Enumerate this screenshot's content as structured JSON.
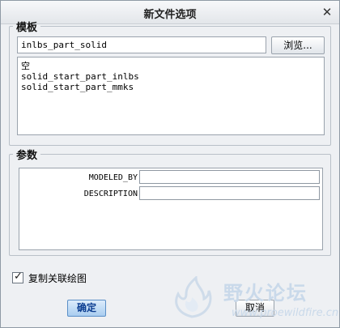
{
  "dialog": {
    "title": "新文件选项",
    "close_icon": "close-icon"
  },
  "template": {
    "legend": "模板",
    "input_value": "inlbs_part_solid",
    "browse_label": "浏览...",
    "items": [
      "空",
      "solid_start_part_inlbs",
      "solid_start_part_mmks"
    ]
  },
  "params": {
    "legend": "参数",
    "rows": [
      {
        "label": "MODELED_BY",
        "value": ""
      },
      {
        "label": "DESCRIPTION",
        "value": ""
      }
    ]
  },
  "copy_assoc": {
    "label": "复制关联绘图",
    "checked": true
  },
  "buttons": {
    "ok_label": "确定",
    "cancel_label": "取消"
  },
  "watermark": {
    "text_cn": "野火论坛",
    "url": "www.proewildfire.cn"
  }
}
